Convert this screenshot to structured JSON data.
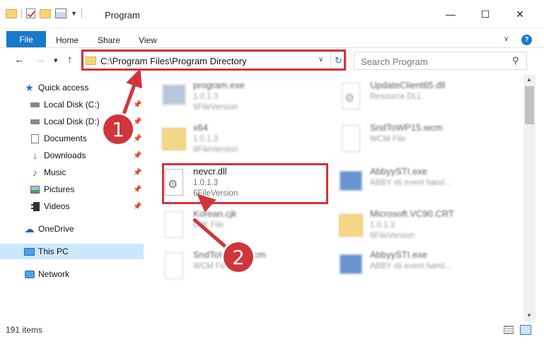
{
  "window": {
    "title": "Program",
    "minimize_glyph": "—",
    "maximize_glyph": "☐",
    "close_glyph": "✕"
  },
  "ribbon": {
    "tabs": [
      "File",
      "Home",
      "Share",
      "View"
    ],
    "help": "?"
  },
  "nav": {
    "back": "←",
    "forward": "→",
    "recent": "▾",
    "up": "↑",
    "address": "C:\\Program Files\\Program Directory",
    "refresh": "↻",
    "search_placeholder": "Search Program"
  },
  "sidebar": {
    "items": [
      {
        "label": "Quick access",
        "icon": "star-icon"
      },
      {
        "label": "Local Disk (C:)",
        "icon": "drive-icon",
        "pinned": true
      },
      {
        "label": "Local Disk (D:)",
        "icon": "drive-icon",
        "pinned": true
      },
      {
        "label": "Documents",
        "icon": "documents-icon",
        "pinned": true
      },
      {
        "label": "Downloads",
        "icon": "downloads-icon",
        "pinned": true
      },
      {
        "label": "Music",
        "icon": "music-icon",
        "pinned": true
      },
      {
        "label": "Pictures",
        "icon": "pictures-icon",
        "pinned": true
      },
      {
        "label": "Videos",
        "icon": "videos-icon",
        "pinned": true
      },
      {
        "label": "OneDrive",
        "icon": "onedrive-icon"
      },
      {
        "label": "This PC",
        "icon": "pc-icon",
        "selected": true
      },
      {
        "label": "Network",
        "icon": "network-icon"
      }
    ]
  },
  "files": [
    {
      "name": "program.exe",
      "line1": "1.0.1.3",
      "line2": "6FileVersion",
      "icon": "exe"
    },
    {
      "name": "UpdateClient65.dll",
      "line1": "Resource DLL",
      "line2": "",
      "icon": "dll"
    },
    {
      "name": "x64",
      "line1": "1.0.1.3",
      "line2": "6FileVersion",
      "icon": "folder"
    },
    {
      "name": "SndToWP15.wcm",
      "line1": "WCM File",
      "line2": "",
      "icon": "doc"
    },
    {
      "name": "nevcr.dll",
      "line1": "1.0.1.3",
      "line2": "6FileVersion",
      "icon": "dll"
    },
    {
      "name": "AbbyySTI.exe",
      "line1": "ABBY sti event hand...",
      "line2": "",
      "icon": "app"
    },
    {
      "name": "Korean.cjk",
      "line1": "CJK File",
      "line2": "",
      "icon": "doc"
    },
    {
      "name": "Microsoft.VC90.CRT",
      "line1": "1.0.1.3",
      "line2": "6FileVersion",
      "icon": "folder"
    },
    {
      "name": "SndToWP15.wcm",
      "line1": "WCM File",
      "line2": "",
      "icon": "doc"
    },
    {
      "name": "AbbyySTI.exe",
      "line1": "ABBY sti event hand...",
      "line2": "",
      "icon": "app"
    }
  ],
  "annotations": {
    "badge1": "1",
    "badge2": "2",
    "color": "#d1343b"
  },
  "status": {
    "items_count": "191 items"
  },
  "colors": {
    "accent": "#1979ca",
    "folder": "#f0c75a",
    "selection": "#cce8ff"
  }
}
